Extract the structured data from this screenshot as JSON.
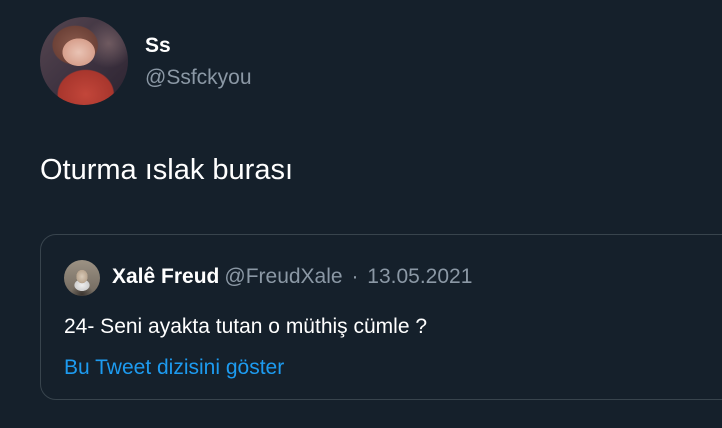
{
  "author": {
    "display_name": "Ss",
    "handle": "@Ssfckyou"
  },
  "tweet": {
    "text": "Oturma ıslak burası"
  },
  "quoted_tweet": {
    "display_name": "Xalê Freud",
    "handle": "@FreudXale",
    "separator": "·",
    "date": "13.05.2021",
    "text": "24- Seni ayakta tutan o müthiş cümle ?",
    "show_thread_label": "Bu Tweet dizisini göster"
  },
  "colors": {
    "background": "#15202b",
    "primary_text": "#ffffff",
    "secondary_text": "#8b98a5",
    "link": "#1d9bf0",
    "border": "#38444d"
  }
}
